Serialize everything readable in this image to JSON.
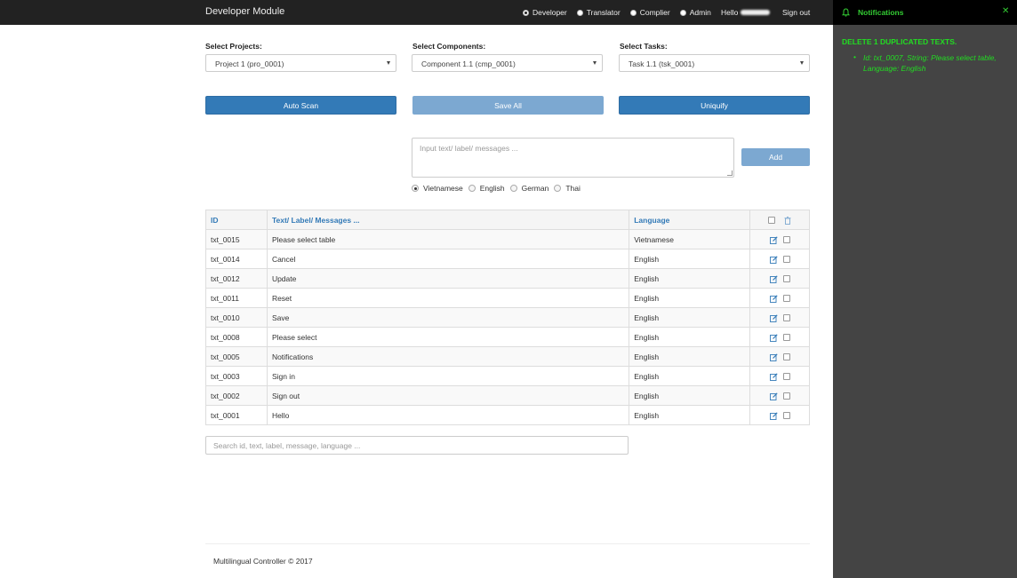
{
  "navbar": {
    "brand": "Developer Module",
    "roles": [
      {
        "label": "Developer",
        "checked": true
      },
      {
        "label": "Translator",
        "checked": false
      },
      {
        "label": "Complier",
        "checked": false
      },
      {
        "label": "Admin",
        "checked": false
      }
    ],
    "hello": "Hello",
    "signout": "Sign out"
  },
  "selects": {
    "projects_label": "Select Projects:",
    "projects_value": "Project 1 (pro_0001)",
    "components_label": "Select Components:",
    "components_value": "Component 1.1 (cmp_0001)",
    "tasks_label": "Select Tasks:",
    "tasks_value": "Task 1.1 (tsk_0001)"
  },
  "buttons": {
    "auto_scan": "Auto Scan",
    "save_all": "Save All",
    "uniquify": "Uniquify",
    "add": "Add"
  },
  "input": {
    "placeholder": "Input text/ label/ messages ..."
  },
  "languages": [
    {
      "label": "Vietnamese",
      "checked": true
    },
    {
      "label": "English",
      "checked": false
    },
    {
      "label": "German",
      "checked": false
    },
    {
      "label": "Thai",
      "checked": false
    }
  ],
  "table": {
    "headers": {
      "id": "ID",
      "text": "Text/ Label/ Messages ...",
      "language": "Language"
    },
    "rows": [
      {
        "id": "txt_0015",
        "text": "Please select table",
        "language": "Vietnamese"
      },
      {
        "id": "txt_0014",
        "text": "Cancel",
        "language": "English"
      },
      {
        "id": "txt_0012",
        "text": "Update",
        "language": "English"
      },
      {
        "id": "txt_0011",
        "text": "Reset",
        "language": "English"
      },
      {
        "id": "txt_0010",
        "text": "Save",
        "language": "English"
      },
      {
        "id": "txt_0008",
        "text": "Please select",
        "language": "English"
      },
      {
        "id": "txt_0005",
        "text": "Notifications",
        "language": "English"
      },
      {
        "id": "txt_0003",
        "text": "Sign in",
        "language": "English"
      },
      {
        "id": "txt_0002",
        "text": "Sign out",
        "language": "English"
      },
      {
        "id": "txt_0001",
        "text": "Hello",
        "language": "English"
      }
    ]
  },
  "search": {
    "placeholder": "Search id, text, label, message, language ..."
  },
  "footer": {
    "text": "Multilingual Controller © 2017"
  },
  "notifications": {
    "title": "Notifications",
    "heading": "DELETE 1 DUPLICATED TEXTS.",
    "items": [
      "Id: txt_0007, String: Please select table, Language: English"
    ],
    "accent": "#33cc33"
  },
  "colors": {
    "primary": "#337ab7",
    "navbar": "#222222",
    "panel": "#444444"
  }
}
